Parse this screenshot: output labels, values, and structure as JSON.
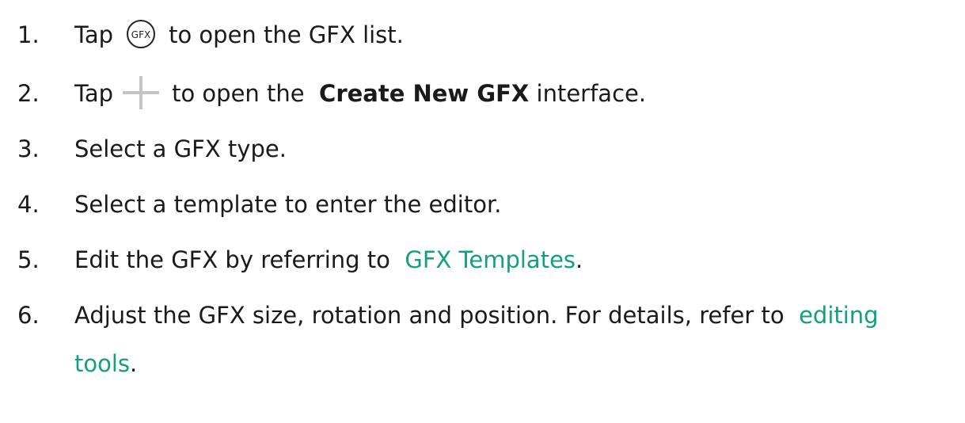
{
  "steps": [
    {
      "number": "1.",
      "pre": "Tap",
      "icon": "gfx-circle-icon",
      "post": "to open the GFX list."
    },
    {
      "number": "2.",
      "pre": "Tap",
      "icon": "plus-icon",
      "mid": "to open the",
      "bold": "Create New GFX",
      "post": "interface."
    },
    {
      "number": "3.",
      "text": "Select a GFX type."
    },
    {
      "number": "4.",
      "text": "Select a template to enter the editor."
    },
    {
      "number": "5.",
      "pre": "Edit the GFX by referring to",
      "link": "GFX Templates",
      "post": "."
    },
    {
      "number": "6.",
      "pre": "Adjust the GFX size, rotation and position. For details, refer to",
      "link": "editing tools",
      "post": "."
    }
  ],
  "icon_label": "GFX",
  "colors": {
    "link": "#12a07e",
    "text": "#1a1a1a",
    "icon": "#222222",
    "plus": "#c4c4c4"
  }
}
